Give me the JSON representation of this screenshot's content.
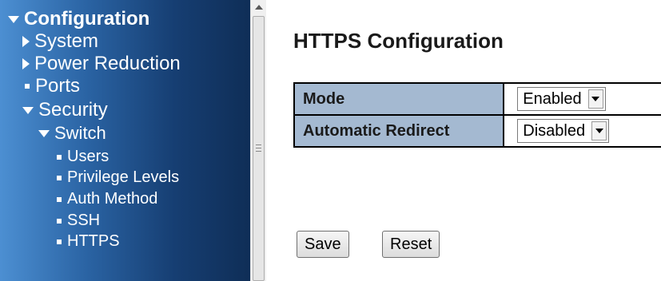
{
  "sidebar": {
    "items": [
      {
        "label": "Configuration",
        "marker": "expanded"
      },
      {
        "label": "System",
        "marker": "collapsed"
      },
      {
        "label": "Power Reduction",
        "marker": "collapsed"
      },
      {
        "label": "Ports",
        "marker": "leaf"
      },
      {
        "label": "Security",
        "marker": "expanded"
      },
      {
        "label": "Switch",
        "marker": "expanded"
      },
      {
        "label": "Users",
        "marker": "leaf"
      },
      {
        "label": "Privilege Levels",
        "marker": "leaf"
      },
      {
        "label": "Auth Method",
        "marker": "leaf"
      },
      {
        "label": "SSH",
        "marker": "leaf"
      },
      {
        "label": "HTTPS",
        "marker": "leaf"
      }
    ]
  },
  "main": {
    "title": "HTTPS Configuration",
    "rows": [
      {
        "label": "Mode",
        "value": "Enabled"
      },
      {
        "label": "Automatic Redirect",
        "value": "Disabled"
      }
    ],
    "save_label": "Save",
    "reset_label": "Reset"
  },
  "colors": {
    "table_label_bg": "#a4b9d1",
    "sidebar_dark": "#0f2e57",
    "sidebar_light": "#4c8fd2"
  }
}
